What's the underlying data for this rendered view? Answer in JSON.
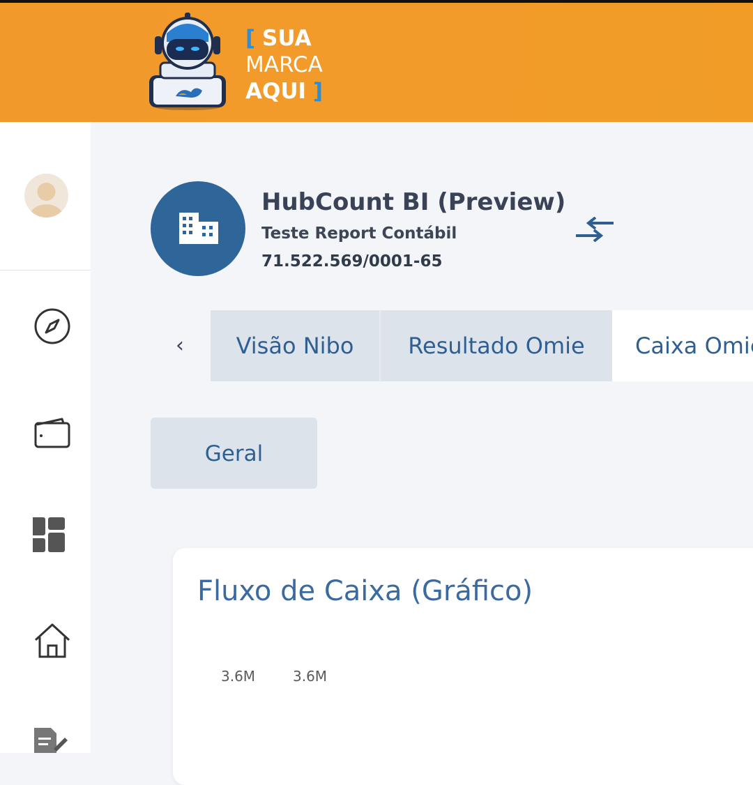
{
  "header": {
    "brand_line1": "SUA",
    "brand_line2": "MARCA",
    "brand_line3": "AQUI",
    "bracket_open": "[",
    "bracket_close": "]",
    "colors": {
      "bar": "#f29b2a",
      "bracket": "#2a8fd6"
    }
  },
  "company": {
    "name": "HubCount BI (Preview)",
    "report": "Teste Report Contábil",
    "cnpj": "71.522.569/0001-65",
    "logo_color": "#2f6699"
  },
  "sidebar": {
    "icons": [
      "user-avatar",
      "compass-icon",
      "wallet-icon",
      "dashboard-icon",
      "home-icon",
      "report-edit-icon"
    ]
  },
  "tabs": {
    "prev_label": "‹",
    "items": [
      {
        "label": "Visão Nibo"
      },
      {
        "label": "Resultado Omie"
      },
      {
        "label": "Caixa Omie"
      }
    ],
    "active_index": 2
  },
  "subtabs": {
    "items": [
      {
        "label": "Geral"
      }
    ]
  },
  "card": {
    "title": "Fluxo de Caixa (Gráfico)",
    "data_labels": [
      "3.6M",
      "3.6M"
    ]
  }
}
